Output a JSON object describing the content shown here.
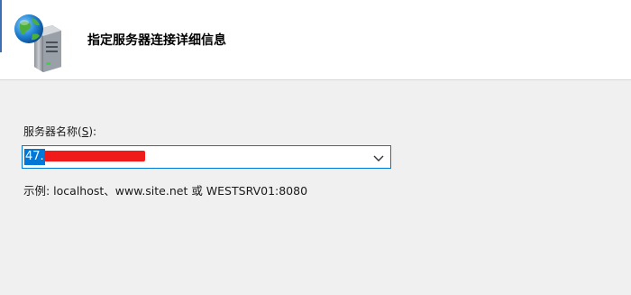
{
  "header": {
    "title": "指定服务器连接详细信息",
    "icon": "server-globe-icon"
  },
  "server_field": {
    "label_prefix": "服务器名称(",
    "mnemonic": "S",
    "label_suffix": "):",
    "value": "47.",
    "icon": "chevron-down-icon"
  },
  "example_text": "示例: localhost、www.site.net 或 WESTSRV01:8080",
  "colors": {
    "accent": "#0078d7",
    "redaction": "#f01a1a",
    "header_bg": "#ffffff",
    "body_bg": "#f0f0f0"
  }
}
